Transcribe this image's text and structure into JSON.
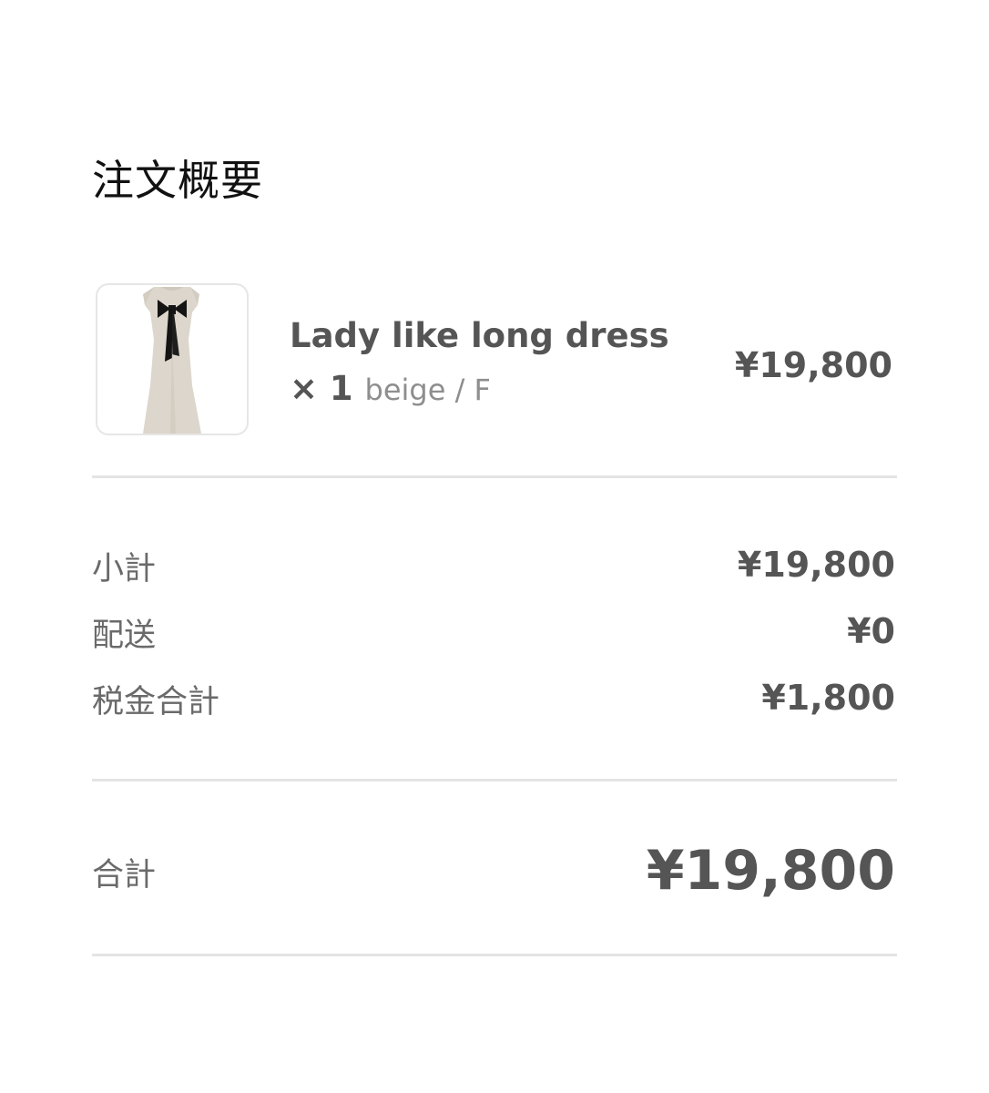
{
  "header": {
    "title": "注文概要"
  },
  "order_item": {
    "name": "Lady like long dress × 1",
    "variant": "beige / F",
    "price": "¥19,800",
    "image_icon": "dress-image"
  },
  "summary": {
    "subtotal_label": "小計",
    "subtotal_value": "¥19,800",
    "shipping_label": "配送",
    "shipping_value": "¥0",
    "tax_label": "税金合計",
    "tax_value": "¥1,800"
  },
  "total": {
    "label": "合計",
    "value": "¥19,800"
  },
  "colors": {
    "text_primary": "#111111",
    "text_secondary": "#555555",
    "divider": "#e4e4e4"
  }
}
